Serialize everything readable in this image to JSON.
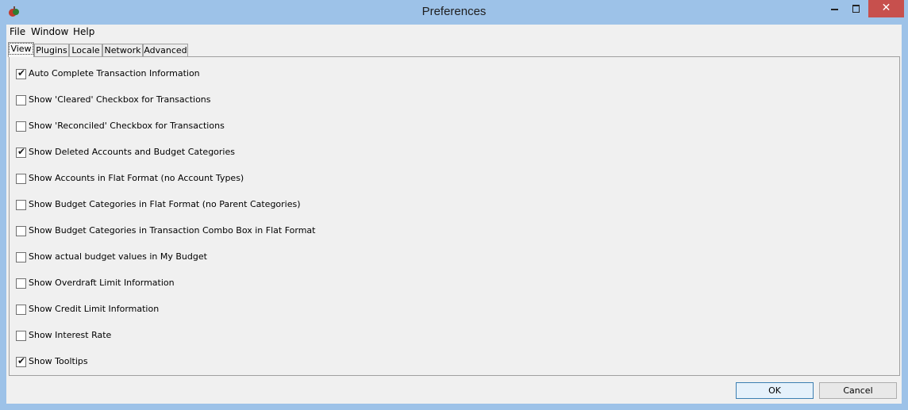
{
  "window": {
    "title": "Preferences",
    "close_glyph": "✕",
    "accent": "#9dc2e8",
    "close_color": "#c7504d"
  },
  "menu": [
    "File",
    "Window",
    "Help"
  ],
  "tabs": [
    "View",
    "Plugins",
    "Locale",
    "Network",
    "Advanced"
  ],
  "active_tab": "View",
  "options": [
    {
      "label": "Auto Complete Transaction Information",
      "checked": true
    },
    {
      "label": "Show 'Cleared' Checkbox for Transactions",
      "checked": false
    },
    {
      "label": "Show 'Reconciled' Checkbox for Transactions",
      "checked": false
    },
    {
      "label": "Show Deleted Accounts and Budget Categories",
      "checked": true
    },
    {
      "label": "Show Accounts in Flat Format (no Account Types)",
      "checked": false
    },
    {
      "label": "Show Budget Categories in Flat Format (no Parent Categories)",
      "checked": false
    },
    {
      "label": "Show Budget Categories in Transaction Combo Box in Flat Format",
      "checked": false
    },
    {
      "label": "Show actual budget values in My Budget",
      "checked": false
    },
    {
      "label": "Show Overdraft Limit Information",
      "checked": false
    },
    {
      "label": "Show Credit Limit Information",
      "checked": false
    },
    {
      "label": "Show Interest Rate",
      "checked": false
    },
    {
      "label": "Show Tooltips",
      "checked": true
    }
  ],
  "check_glyph": "✔",
  "buttons": {
    "ok": "OK",
    "cancel": "Cancel"
  },
  "icons": [
    "app-icon",
    "minimize-icon",
    "maximize-icon",
    "close-icon",
    "checkmark-icon"
  ]
}
